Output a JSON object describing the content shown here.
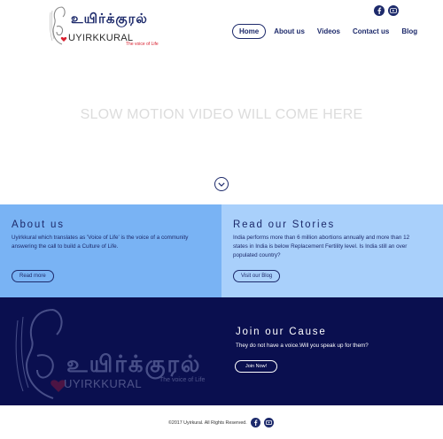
{
  "header": {
    "logo_tamil": "உயிர்க்குரல்",
    "logo_name": "UYIRKKURAL",
    "logo_tagline": "The voice of Life",
    "social": [
      "facebook-icon",
      "youtube-icon"
    ]
  },
  "nav": {
    "items": [
      {
        "label": "Home"
      },
      {
        "label": "About us"
      },
      {
        "label": "Videos"
      },
      {
        "label": "Contact us"
      },
      {
        "label": "Blog"
      }
    ]
  },
  "hero": {
    "text": "SLOW MOTION VIDEO WILL COME HERE"
  },
  "about": {
    "title": "About us",
    "body": "Uyirkkural which translates as 'Voice of Life' is the voice of a community answering the call to build a Culture of Life.",
    "button": "Read more",
    "bg": "#79b3f4"
  },
  "stories": {
    "title": "Read our Stories",
    "body": "India performs more than 6 million abortions annually and more than 12 states in India is below Replacement Fertility level. Is India still an over populated country?",
    "button": "Visit our Blog",
    "bg": "#a9d0fb"
  },
  "cause": {
    "logo_tamil": "உயிர்க்குரல்",
    "logo_name": "UYIRKKURAL",
    "logo_tagline": "The voice of Life",
    "title": "Join our Cause",
    "body": "They do not have a voice.Will you speak up for them?",
    "button": "Join Now!",
    "bg": "#0a0f4f"
  },
  "footer": {
    "copyright": "©2017 Uyirkural. All Rights Reserved."
  },
  "colors": {
    "brand_navy": "#1d2a6b",
    "accent_red": "#d8202f"
  }
}
